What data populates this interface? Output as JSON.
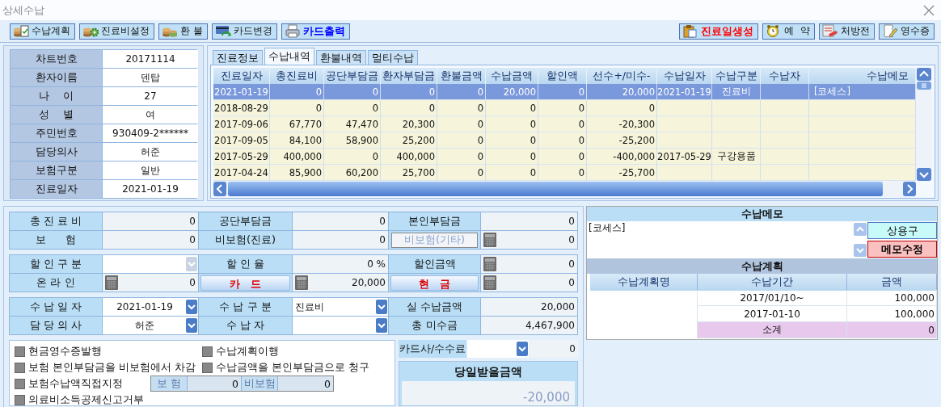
{
  "window": {
    "title": "상세수납"
  },
  "toolbar": {
    "left": [
      {
        "label": "수납계획"
      },
      {
        "label": "진료비설정"
      },
      {
        "label": "환 불"
      },
      {
        "label": "카드변경"
      },
      {
        "label": "카드출력",
        "color": "#0000ff"
      }
    ],
    "right": [
      {
        "label": "진료일생성",
        "color": "#ff0000"
      },
      {
        "label": "예  약"
      },
      {
        "label": "처방전"
      },
      {
        "label": "영수증"
      }
    ]
  },
  "patient": [
    {
      "label": "차트번호",
      "value": "20171114"
    },
    {
      "label": "환자이름",
      "value": "덴탑"
    },
    {
      "label": "나    이",
      "value": "27"
    },
    {
      "label": "성    별",
      "value": "여"
    },
    {
      "label": "주민번호",
      "value": "930409-2******"
    },
    {
      "label": "담당의사",
      "value": "허준"
    },
    {
      "label": "보험구분",
      "value": "일반"
    },
    {
      "label": "진료일자",
      "value": "2021-01-19"
    }
  ],
  "tabs": [
    {
      "label": "진료정보",
      "selected": false
    },
    {
      "label": "수납내역",
      "selected": true
    },
    {
      "label": "환불내역",
      "selected": false
    },
    {
      "label": "멀티수납",
      "selected": false
    }
  ],
  "table": {
    "columns": [
      "진료일자",
      "총진료비",
      "공단부담금",
      "환자부담금",
      "환불금액",
      "수납금액",
      "할인액",
      "선수+/미수-",
      "수납일자",
      "수납구분",
      "수납자",
      "수납메모"
    ],
    "rows": [
      {
        "selected": true,
        "cells": [
          "2021-01-19",
          "0",
          "0",
          "0",
          "0",
          "20,000",
          "0",
          "20,000",
          "2021-01-19",
          "진료비",
          null,
          "[코세스]"
        ]
      },
      {
        "selected": false,
        "cells": [
          "2018-08-29",
          "0",
          "0",
          "0",
          "0",
          "0",
          "0",
          "0"
        ]
      },
      {
        "selected": false,
        "cells": [
          "2017-09-06",
          "67,770",
          "47,470",
          "20,300",
          "0",
          "0",
          "0",
          "-20,300"
        ]
      },
      {
        "selected": false,
        "cells": [
          "2017-09-05",
          "84,100",
          "58,900",
          "25,200",
          "0",
          "0",
          "0",
          "-25,200"
        ]
      },
      {
        "selected": false,
        "cells": [
          "2017-05-29",
          "400,000",
          "0",
          "400,000",
          "0",
          "0",
          "0",
          "-400,000",
          "2017-05-29",
          "구강용품"
        ]
      },
      {
        "selected": false,
        "cells": [
          "2017-04-24",
          "85,900",
          "60,200",
          "25,700",
          "0",
          "0",
          "0",
          "-25,700"
        ]
      }
    ]
  },
  "payment": {
    "groups": [
      {
        "rows": [
          [
            {
              "kind": "label",
              "text": "총 진 료 비"
            },
            {
              "kind": "value",
              "text": "0"
            },
            {
              "kind": "label",
              "text": "공단부담금"
            },
            {
              "kind": "value",
              "text": "0"
            },
            {
              "kind": "label",
              "text": "본인부담금"
            },
            {
              "kind": "value",
              "text": "0"
            }
          ],
          [
            {
              "kind": "label",
              "text": "보      험"
            },
            {
              "kind": "value",
              "text": "0"
            },
            {
              "kind": "label",
              "text": "비보험(진료)"
            },
            {
              "kind": "value",
              "text": "0"
            },
            {
              "kind": "label",
              "text": "비보험(기타)",
              "disabled": true
            },
            {
              "kind": "value",
              "text": "0",
              "calc": true
            }
          ]
        ]
      },
      {
        "rows": [
          [
            {
              "kind": "label",
              "text": "할 인 구 분"
            },
            {
              "kind": "select",
              "disabled": true
            },
            {
              "kind": "label",
              "text": "할 인 율"
            },
            {
              "kind": "value",
              "text": "0 %"
            },
            {
              "kind": "label",
              "text": "할인금액"
            },
            {
              "kind": "value",
              "text": "0",
              "calc": true
            }
          ],
          [
            {
              "kind": "label",
              "text": "온 라 인"
            },
            {
              "kind": "value",
              "text": "0",
              "calc": true
            },
            {
              "kind": "button",
              "text": "카   드"
            },
            {
              "kind": "value",
              "text": "20,000",
              "calc": true
            },
            {
              "kind": "button",
              "text": "현   금"
            },
            {
              "kind": "value",
              "text": "0",
              "calc": true
            }
          ]
        ]
      },
      {
        "rows": [
          [
            {
              "kind": "label",
              "text": "수 납 일 자"
            },
            {
              "kind": "select",
              "text": "2021-01-19",
              "disabled": false
            },
            {
              "kind": "label",
              "text": "수 납 구 분"
            },
            {
              "kind": "select",
              "text": "진료비",
              "disabled": false
            },
            {
              "kind": "label",
              "text": "실 수납금액"
            },
            {
              "kind": "value",
              "text": "20,000"
            }
          ],
          [
            {
              "kind": "label",
              "text": "담 당 의 사"
            },
            {
              "kind": "select",
              "text": "허준",
              "disabled": false
            },
            {
              "kind": "label",
              "text": "수 납 자"
            },
            {
              "kind": "select",
              "disabled": false
            },
            {
              "kind": "label",
              "text": "총 미수금"
            },
            {
              "kind": "value",
              "text": "4,467,900"
            }
          ]
        ]
      }
    ]
  },
  "options": [
    {
      "label": "현금영수증발행",
      "checked": false
    },
    {
      "label": "수납계획이행",
      "checked": false
    },
    {
      "label": "보험 본인부담금을 비보험에서 차감",
      "checked": false
    },
    {
      "label": "수납금액을 본인부담금으로 청구",
      "checked": false
    },
    {
      "label": "보험수납액직접지정",
      "checked": false,
      "amounts": [
        {
          "label": "보 험",
          "value": "0"
        },
        {
          "label": "비보험",
          "value": "0"
        }
      ]
    },
    {
      "label": "의료비소득공제신고거부",
      "checked": false
    }
  ],
  "card_fee": {
    "label": "카드사/수수료",
    "value": "0"
  },
  "due": {
    "title": "당일받을금액",
    "value": "-20,000"
  },
  "memo": {
    "title": "수납메모",
    "text": "[코세스]",
    "buttons": [
      {
        "label": "상용구",
        "kind": "phrase"
      },
      {
        "label": "메모수정",
        "kind": "edit"
      }
    ]
  },
  "plan": {
    "title": "수납계획",
    "columns": [
      "수납계획명",
      "수납기간",
      "금액"
    ],
    "rows": [
      {
        "period": "2017/01/10~",
        "amount": "100,000"
      },
      {
        "period": "2017-01-10",
        "amount": "100,000"
      }
    ],
    "subtotal": {
      "label": "소계",
      "amount": "0"
    }
  }
}
